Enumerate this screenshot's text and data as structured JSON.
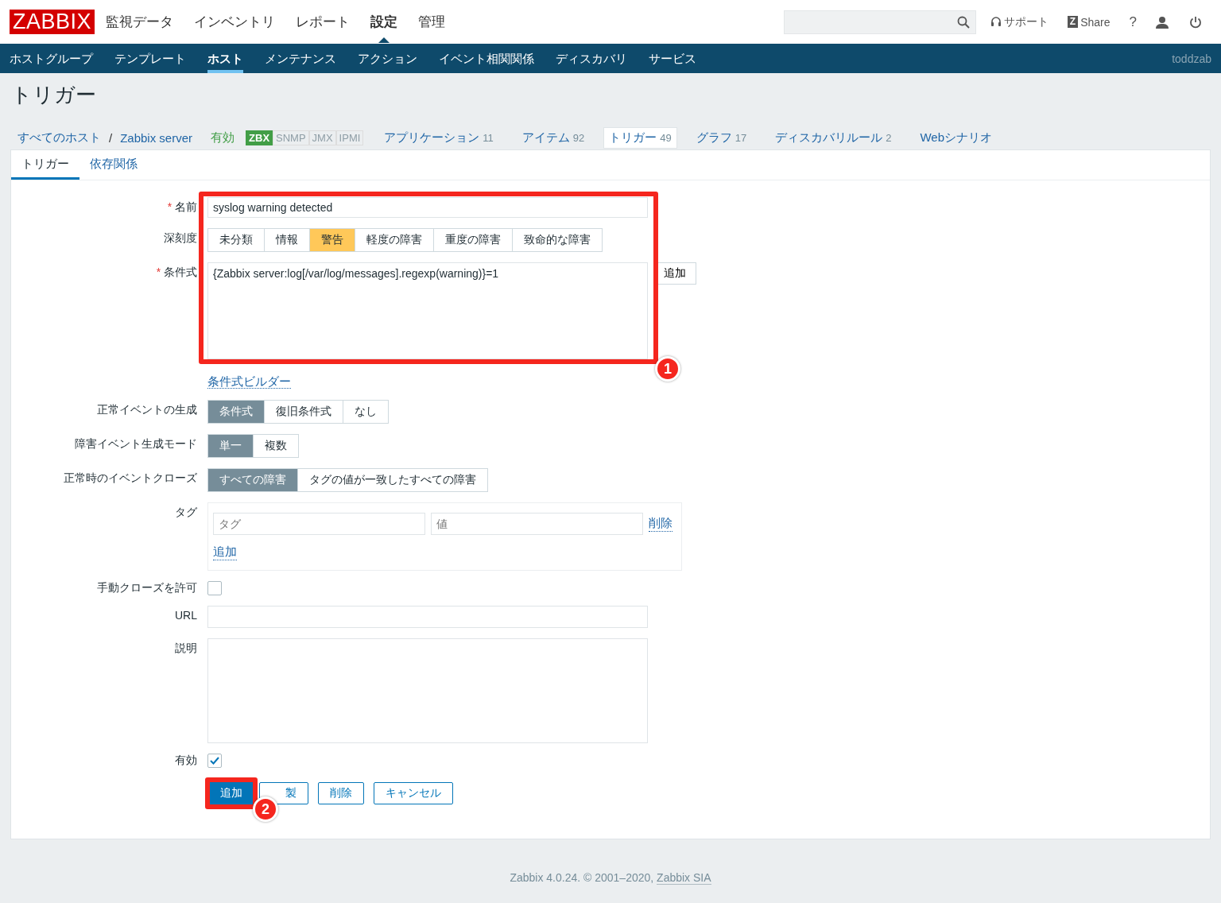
{
  "header": {
    "logo": "ZABBIX",
    "menu": [
      {
        "label": "監視データ",
        "selected": false
      },
      {
        "label": "インベントリ",
        "selected": false
      },
      {
        "label": "レポート",
        "selected": false
      },
      {
        "label": "設定",
        "selected": true
      },
      {
        "label": "管理",
        "selected": false
      }
    ],
    "links": [
      {
        "kind": "support",
        "label": "サポート"
      },
      {
        "kind": "share",
        "badge": "Z",
        "label": "Share"
      },
      {
        "kind": "help",
        "label": "?"
      }
    ]
  },
  "subnav": {
    "items": [
      {
        "label": "ホストグループ",
        "selected": false
      },
      {
        "label": "テンプレート",
        "selected": false
      },
      {
        "label": "ホスト",
        "selected": true
      },
      {
        "label": "メンテナンス",
        "selected": false
      },
      {
        "label": "アクション",
        "selected": false
      },
      {
        "label": "イベント相関関係",
        "selected": false
      },
      {
        "label": "ディスカバリ",
        "selected": false
      },
      {
        "label": "サービス",
        "selected": false
      }
    ],
    "user": "toddzab"
  },
  "page_title": "トリガー",
  "breadcrumbs": {
    "all_hosts": "すべてのホスト",
    "separator": "/",
    "host": "Zabbix server",
    "status": "有効",
    "availability": [
      {
        "label": "ZBX",
        "on": true
      },
      {
        "label": "SNMP",
        "on": false
      },
      {
        "label": "JMX",
        "on": false
      },
      {
        "label": "IPMI",
        "on": false
      }
    ],
    "links": [
      {
        "label": "アプリケーション",
        "count": "11",
        "selected": false
      },
      {
        "label": "アイテム",
        "count": "92",
        "selected": false
      },
      {
        "label": "トリガー",
        "count": "49",
        "selected": true
      },
      {
        "label": "グラフ",
        "count": "17",
        "selected": false
      },
      {
        "label": "ディスカバリルール",
        "count": "2",
        "selected": false
      },
      {
        "label": "Webシナリオ",
        "selected": false
      }
    ]
  },
  "form_tabs": [
    {
      "label": "トリガー",
      "selected": true
    },
    {
      "label": "依存関係",
      "selected": false
    }
  ],
  "form": {
    "name": {
      "label": "名前",
      "required_mark": "*",
      "value": "syslog warning detected"
    },
    "severity": {
      "label": "深刻度",
      "options": [
        {
          "label": "未分類",
          "selected": false
        },
        {
          "label": "情報",
          "selected": false
        },
        {
          "label": "警告",
          "selected": true
        },
        {
          "label": "軽度の障害",
          "selected": false
        },
        {
          "label": "重度の障害",
          "selected": false
        },
        {
          "label": "致命的な障害",
          "selected": false
        }
      ]
    },
    "expression": {
      "label": "条件式",
      "required_mark": "*",
      "value": "{Zabbix server:log[/var/log/messages].regexp(warning)}=1",
      "add_button": "追加"
    },
    "builder_link": "条件式ビルダー",
    "ok_event": {
      "label": "正常イベントの生成",
      "options": [
        {
          "label": "条件式",
          "selected": true
        },
        {
          "label": "復旧条件式",
          "selected": false
        },
        {
          "label": "なし",
          "selected": false
        }
      ]
    },
    "event_mode": {
      "label": "障害イベント生成モード",
      "options": [
        {
          "label": "単一",
          "selected": true
        },
        {
          "label": "複数",
          "selected": false
        }
      ]
    },
    "ok_close": {
      "label": "正常時のイベントクローズ",
      "options": [
        {
          "label": "すべての障害",
          "selected": true
        },
        {
          "label": "タグの値が一致したすべての障害",
          "selected": false
        }
      ]
    },
    "tags": {
      "label": "タグ",
      "rows": [
        {
          "tag_placeholder": "タグ",
          "value_placeholder": "値",
          "remove": "削除"
        }
      ],
      "add": "追加"
    },
    "manual_close": {
      "label": "手動クローズを許可",
      "checked": false
    },
    "url": {
      "label": "URL"
    },
    "description": {
      "label": "説明"
    },
    "enabled": {
      "label": "有効",
      "checked": true
    },
    "buttons": [
      {
        "label": "追加",
        "kind": "primary"
      },
      {
        "label": "製",
        "kind": "secondary"
      },
      {
        "label": "削除",
        "kind": "secondary"
      },
      {
        "label": "キャンセル",
        "kind": "secondary"
      }
    ]
  },
  "annotations": [
    {
      "number": "1"
    },
    {
      "number": "2"
    }
  ],
  "footer": {
    "text": "Zabbix 4.0.24. © 2001–2020, ",
    "link": "Zabbix SIA"
  }
}
